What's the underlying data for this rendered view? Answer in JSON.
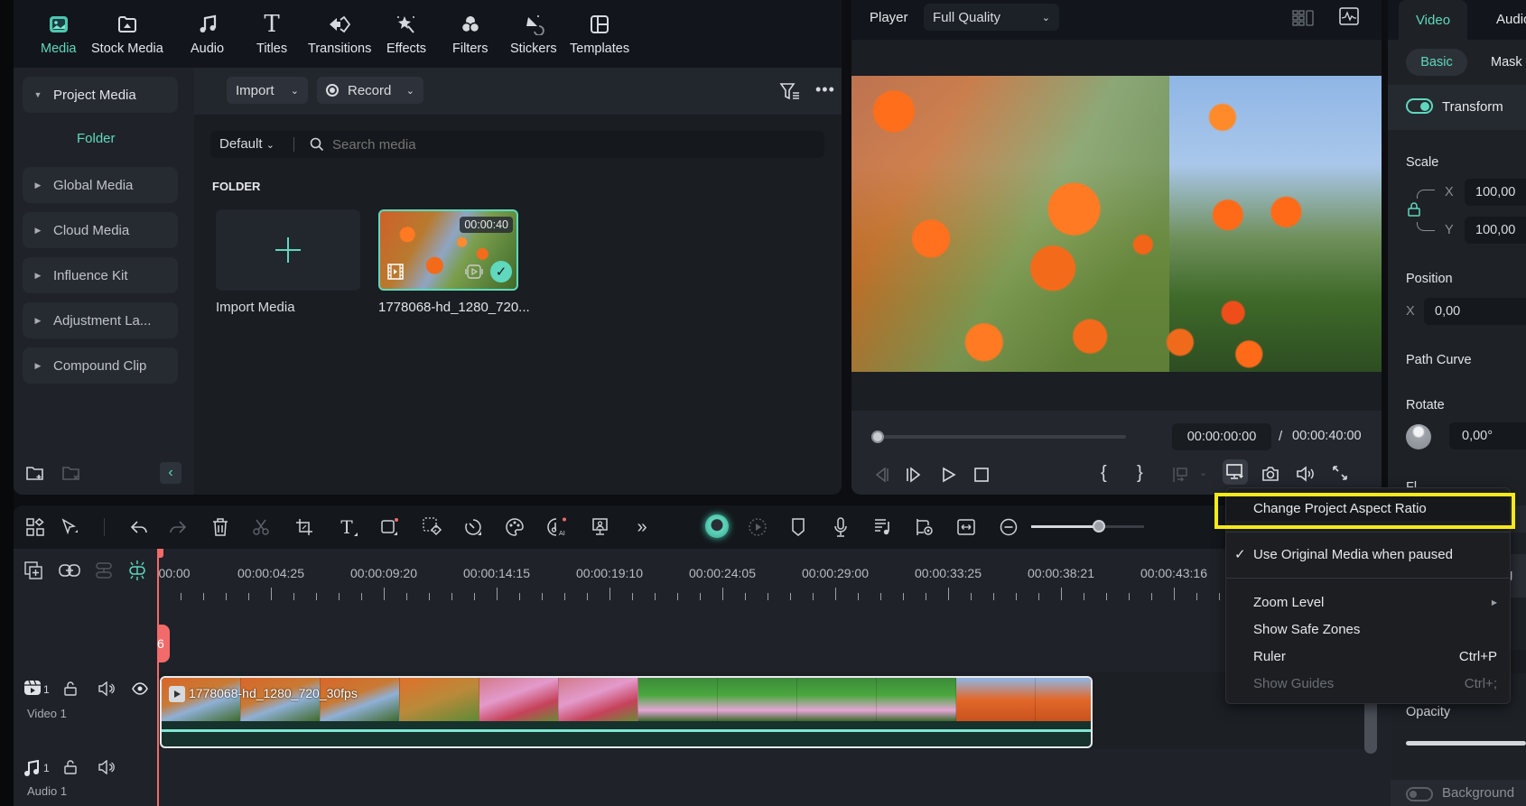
{
  "nav": {
    "items": [
      {
        "label": "Media",
        "icon": "media-icon",
        "active": true
      },
      {
        "label": "Stock Media",
        "icon": "stock-media-icon"
      },
      {
        "label": "Audio",
        "icon": "music-note-icon"
      },
      {
        "label": "Titles",
        "icon": "titles-T-icon"
      },
      {
        "label": "Transitions",
        "icon": "transitions-icon"
      },
      {
        "label": "Effects",
        "icon": "effects-star-icon"
      },
      {
        "label": "Filters",
        "icon": "filters-icon"
      },
      {
        "label": "Stickers",
        "icon": "stickers-icon"
      },
      {
        "label": "Templates",
        "icon": "templates-icon"
      }
    ]
  },
  "sidebar": {
    "project_media": "Project Media",
    "folder": "Folder",
    "items": [
      "Global Media",
      "Cloud Media",
      "Influence Kit",
      "Adjustment La...",
      "Compound Clip"
    ]
  },
  "media": {
    "import_label": "Import",
    "record_label": "Record",
    "sort_label": "Default",
    "search_placeholder": "Search media",
    "section_title": "FOLDER",
    "import_media_label": "Import Media",
    "clip": {
      "name": "1778068-hd_1280_720...",
      "duration": "00:00:40"
    }
  },
  "player": {
    "label": "Player",
    "quality": "Full Quality",
    "current_time": "00:00:00:00",
    "separator": "/",
    "total_time": "00:00:40:00",
    "progress": 0
  },
  "right_panel": {
    "tabs": [
      "Video",
      "Audio"
    ],
    "subtabs": [
      "Basic",
      "Mask"
    ],
    "transform_label": "Transform",
    "transform_on": true,
    "scale_label": "Scale",
    "scale_x_label": "X",
    "scale_x": "100,00",
    "scale_y_label": "Y",
    "scale_y": "100,00",
    "position_label": "Position",
    "pos_x_label": "X",
    "pos_x": "0,00",
    "path_curve_label": "Path Curve",
    "rotate_label": "Rotate",
    "rotate_value": "0,00°",
    "flip_label_partial": "Fl",
    "hidden_row_partial": "g",
    "opacity_label": "Opacity",
    "background_label": "Background"
  },
  "timeline": {
    "ruler_labels": [
      "00:00",
      "00:00:04:25",
      "00:00:09:20",
      "00:00:14:15",
      "00:00:19:10",
      "00:00:24:05",
      "00:00:29:00",
      "00:00:33:25",
      "00:00:38:21",
      "00:00:43:16"
    ],
    "playhead_badge": "6",
    "video_track": {
      "number": "1",
      "name": "Video 1"
    },
    "audio_track": {
      "number": "1",
      "name": "Audio 1"
    },
    "clip_name": "1778068-hd_1280_720_30fps",
    "zoom_slider": 0.6
  },
  "context_menu": {
    "items": [
      {
        "label": "Change Project Aspect Ratio",
        "highlighted": true
      },
      {
        "label": "Use Original Media when paused",
        "checked": true
      },
      {
        "label": "Zoom Level",
        "submenu": true
      },
      {
        "label": "Show Safe Zones"
      },
      {
        "label": "Ruler",
        "shortcut": "Ctrl+P"
      },
      {
        "label": "Show Guides",
        "shortcut": "Ctrl+;",
        "disabled": true
      }
    ]
  },
  "colors": {
    "accent": "#5fd8bd",
    "highlight": "#f4ea1a",
    "playhead": "#f26a6a"
  }
}
